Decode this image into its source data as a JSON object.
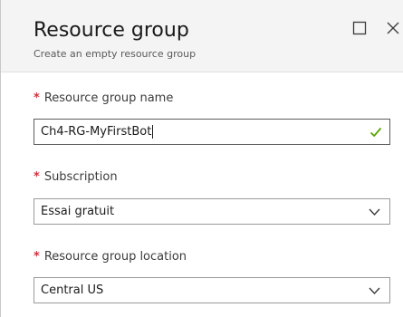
{
  "header": {
    "title": "Resource group",
    "subtitle": "Create an empty resource group"
  },
  "form": {
    "required_marker": "*",
    "name": {
      "label": "Resource group name",
      "value": "Ch4-RG-MyFirstBot",
      "validation_icon": "checkmark-icon"
    },
    "subscription": {
      "label": "Subscription",
      "value": "Essai gratuit"
    },
    "location": {
      "label": "Resource group location",
      "value": "Central US"
    }
  },
  "colors": {
    "required": "#d13438",
    "valid": "#57a300",
    "header_bg": "#f4f4f4"
  }
}
